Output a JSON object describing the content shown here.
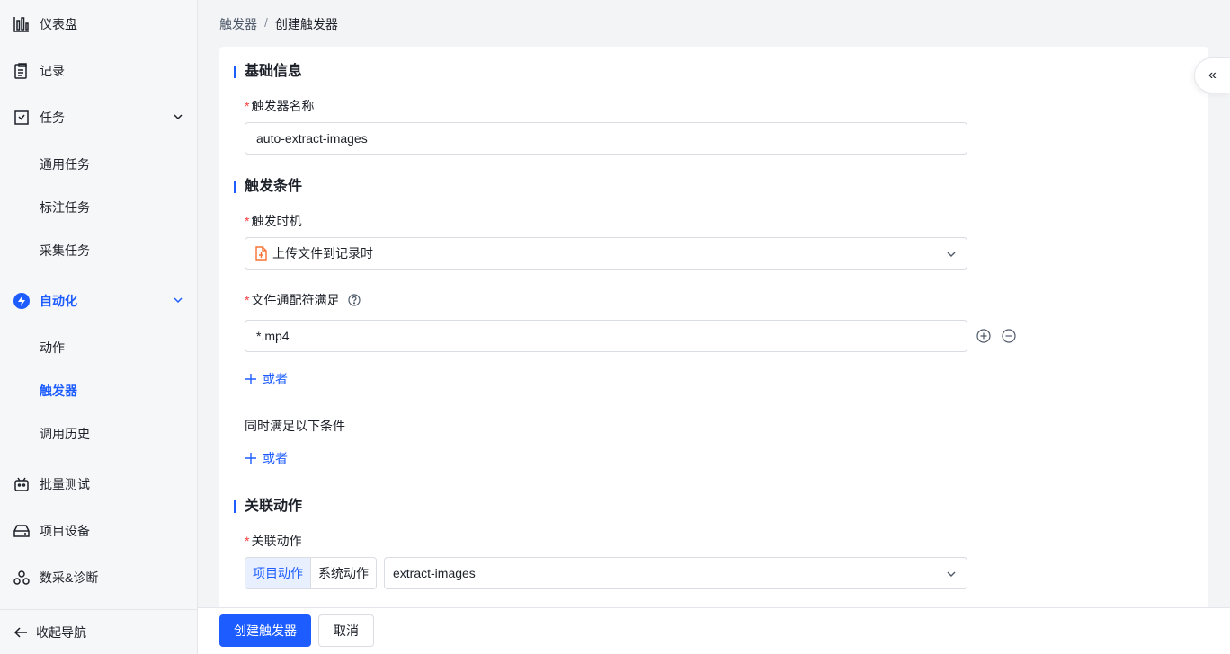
{
  "sidebar": {
    "items": [
      {
        "label": "仪表盘",
        "icon": "chart-bars-icon"
      },
      {
        "label": "记录",
        "icon": "clipboard-icon"
      },
      {
        "label": "任务",
        "icon": "task-icon"
      },
      {
        "label": "通用任务"
      },
      {
        "label": "标注任务"
      },
      {
        "label": "采集任务"
      },
      {
        "label": "自动化",
        "icon": "automation-icon"
      },
      {
        "label": "动作"
      },
      {
        "label": "触发器"
      },
      {
        "label": "调用历史"
      },
      {
        "label": "批量测试",
        "icon": "robot-icon"
      },
      {
        "label": "项目设备",
        "icon": "device-icon"
      },
      {
        "label": "数采&诊断",
        "icon": "diagnose-icon"
      }
    ],
    "collapse_label": "收起导航"
  },
  "breadcrumb": {
    "parent": "触发器",
    "separator": "/",
    "current": "创建触发器"
  },
  "form": {
    "section_basic": "基础信息",
    "name_label": "触发器名称",
    "name_value": "auto-extract-images",
    "section_condition": "触发条件",
    "timing_label": "触发时机",
    "timing_value": "上传文件到记录时",
    "wildcard_label": "文件通配符满足",
    "wildcard_value": "*.mp4",
    "or_label": "或者",
    "also_label": "同时满足以下条件",
    "or_label_2": "或者",
    "section_action": "关联动作",
    "action_label": "关联动作",
    "action_tab_project": "项目动作",
    "action_tab_system": "系统动作",
    "action_value": "extract-images"
  },
  "footer": {
    "create_label": "创建触发器",
    "cancel_label": "取消"
  },
  "panel_toggle": "«",
  "colors": {
    "primary": "#1d5cff",
    "required": "#f53f3f",
    "file_icon": "#f77234"
  }
}
